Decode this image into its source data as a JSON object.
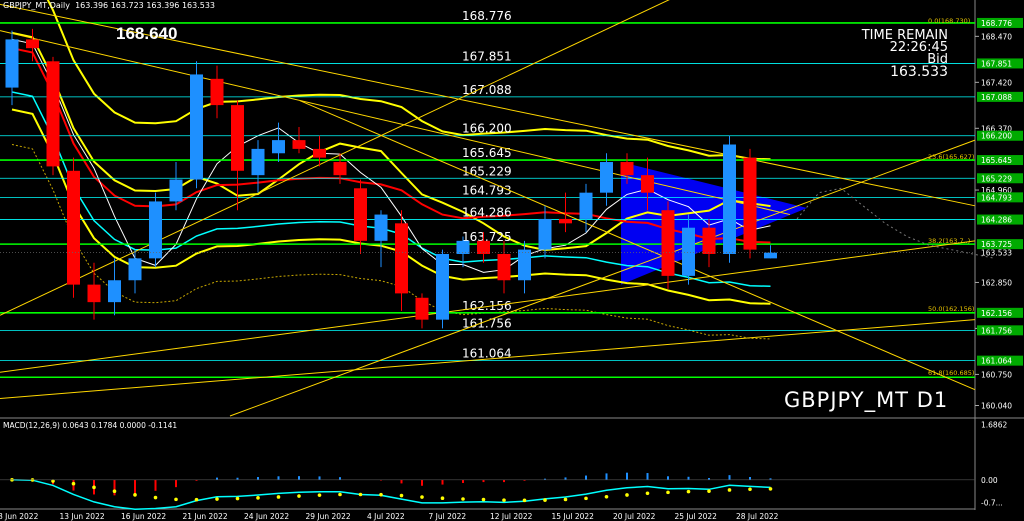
{
  "header": {
    "title": "GBPJPY_MT,Daily  163.396 163.723 163.396 163.533"
  },
  "high_label": "168.640",
  "timer": {
    "label": "TIME REMAIN",
    "value": "22:26:45",
    "bid_label": "Bid",
    "bid_value": "163.533"
  },
  "symbol_label": "GBPJPY_MT D1",
  "macd_header": "MACD(12,26,9) 0.0643 0.1784 0.0000 -0.1141",
  "colors": {
    "background": "#000000",
    "bull": "#1e90ff",
    "bear": "#ff0000",
    "level_line": "#00ff00",
    "level_thin": "#00ffff",
    "trend": "#ffd700",
    "ma_red": "#ff0000",
    "ma_cyan": "#00ffff",
    "ma_white": "#ffffff",
    "envelope": "#ffff00",
    "triangle": "#0000ff",
    "macd_signal": "#ffff00"
  },
  "chart_data": [
    {
      "type": "candlestick",
      "ylim": [
        159.8,
        169.3
      ],
      "price_axis_ticks": [
        "168.470",
        "167.420",
        "166.370",
        "164.960",
        "162.850",
        "161.800",
        "160.750",
        "160.040"
      ],
      "price_axis_labels": [
        {
          "value": 168.776,
          "text": "168.776"
        },
        {
          "value": 168.47,
          "text": "168.470"
        },
        {
          "value": 167.851,
          "text": "167.851"
        },
        {
          "value": 167.42,
          "text": "167.420"
        },
        {
          "value": 167.088,
          "text": "167.088"
        },
        {
          "value": 166.37,
          "text": "166.370"
        },
        {
          "value": 166.2,
          "text": "166.200"
        },
        {
          "value": 165.645,
          "text": "165.645"
        },
        {
          "value": 165.229,
          "text": "165.229"
        },
        {
          "value": 164.96,
          "text": "164.960"
        },
        {
          "value": 164.793,
          "text": "164.793"
        },
        {
          "value": 164.286,
          "text": "164.286"
        },
        {
          "value": 163.725,
          "text": "163.725"
        },
        {
          "value": 163.533,
          "text": "163.533"
        },
        {
          "value": 162.85,
          "text": "162.850"
        },
        {
          "value": 162.156,
          "text": "162.156"
        },
        {
          "value": 161.756,
          "text": "161.756"
        },
        {
          "value": 161.064,
          "text": "161.064"
        },
        {
          "value": 160.75,
          "text": "160.750"
        },
        {
          "value": 160.04,
          "text": "160.040"
        }
      ],
      "levels": [
        {
          "price": 168.776,
          "label": "168.776",
          "style": "bold"
        },
        {
          "price": 167.851,
          "label": "167.851",
          "style": "thin"
        },
        {
          "price": 167.088,
          "label": "167.088",
          "style": "thin"
        },
        {
          "price": 166.2,
          "label": "166.200",
          "style": "thin"
        },
        {
          "price": 165.645,
          "label": "165.645",
          "style": "bold"
        },
        {
          "price": 165.229,
          "label": "165.229",
          "style": "thin"
        },
        {
          "price": 164.793,
          "label": "164.793",
          "style": "thin"
        },
        {
          "price": 164.286,
          "label": "164.286",
          "style": "thin"
        },
        {
          "price": 163.725,
          "label": "163.725",
          "style": "bold"
        },
        {
          "price": 162.156,
          "label": "162.156",
          "style": "bold"
        },
        {
          "price": 161.756,
          "label": "161.756",
          "style": "thin"
        },
        {
          "price": 161.064,
          "label": "161.064",
          "style": "thin"
        },
        {
          "price": 160.685,
          "label": "",
          "style": "bold"
        }
      ],
      "fib_labels": [
        {
          "price": 168.73,
          "text": "0.0(168.730)"
        },
        {
          "price": 165.627,
          "text": "23.6(165.627)"
        },
        {
          "price": 163.7,
          "text": "38.2(163.7..)"
        },
        {
          "price": 162.156,
          "text": "50.0(162.156)"
        },
        {
          "price": 160.685,
          "text": "61.8(160.685)"
        }
      ],
      "x_labels": [
        {
          "bar": 0,
          "text": "8 Jun 2022"
        },
        {
          "bar": 3,
          "text": "13 Jun 2022"
        },
        {
          "bar": 6,
          "text": "16 Jun 2022"
        },
        {
          "bar": 9,
          "text": "21 Jun 2022"
        },
        {
          "bar": 12,
          "text": "24 Jun 2022"
        },
        {
          "bar": 15,
          "text": "29 Jun 2022"
        },
        {
          "bar": 18,
          "text": "4 Jul 2022"
        },
        {
          "bar": 21,
          "text": "7 Jul 2022"
        },
        {
          "bar": 24,
          "text": "12 Jul 2022"
        },
        {
          "bar": 27,
          "text": "15 Jul 2022"
        },
        {
          "bar": 30,
          "text": "20 Jul 2022"
        },
        {
          "bar": 33,
          "text": "25 Jul 2022"
        },
        {
          "bar": 36,
          "text": "28 Jul 2022"
        }
      ],
      "candles": [
        {
          "o": 167.3,
          "h": 168.6,
          "l": 166.9,
          "c": 168.4
        },
        {
          "o": 168.4,
          "h": 168.64,
          "l": 167.9,
          "c": 168.2
        },
        {
          "o": 167.9,
          "h": 168.0,
          "l": 165.3,
          "c": 165.5
        },
        {
          "o": 165.4,
          "h": 165.7,
          "l": 162.5,
          "c": 162.8
        },
        {
          "o": 162.8,
          "h": 163.3,
          "l": 162.0,
          "c": 162.4
        },
        {
          "o": 162.4,
          "h": 163.4,
          "l": 162.1,
          "c": 162.9
        },
        {
          "o": 162.9,
          "h": 163.6,
          "l": 162.6,
          "c": 163.4
        },
        {
          "o": 163.4,
          "h": 164.9,
          "l": 163.2,
          "c": 164.7
        },
        {
          "o": 164.7,
          "h": 165.6,
          "l": 164.5,
          "c": 165.2
        },
        {
          "o": 165.2,
          "h": 167.9,
          "l": 165.0,
          "c": 167.6
        },
        {
          "o": 167.5,
          "h": 167.8,
          "l": 166.6,
          "c": 166.9
        },
        {
          "o": 166.9,
          "h": 167.0,
          "l": 164.5,
          "c": 165.4
        },
        {
          "o": 165.3,
          "h": 166.1,
          "l": 164.9,
          "c": 165.9
        },
        {
          "o": 165.8,
          "h": 166.5,
          "l": 165.6,
          "c": 166.1
        },
        {
          "o": 166.1,
          "h": 166.4,
          "l": 165.8,
          "c": 165.9
        },
        {
          "o": 165.9,
          "h": 166.2,
          "l": 165.5,
          "c": 165.7
        },
        {
          "o": 165.6,
          "h": 165.8,
          "l": 165.1,
          "c": 165.3
        },
        {
          "o": 165.0,
          "h": 165.2,
          "l": 163.5,
          "c": 163.8
        },
        {
          "o": 163.8,
          "h": 164.5,
          "l": 163.2,
          "c": 164.4
        },
        {
          "o": 164.2,
          "h": 164.5,
          "l": 162.2,
          "c": 162.6
        },
        {
          "o": 162.5,
          "h": 162.6,
          "l": 161.8,
          "c": 162.0
        },
        {
          "o": 162.0,
          "h": 163.6,
          "l": 161.8,
          "c": 163.5
        },
        {
          "o": 163.5,
          "h": 163.9,
          "l": 163.2,
          "c": 163.8
        },
        {
          "o": 163.8,
          "h": 164.0,
          "l": 163.3,
          "c": 163.5
        },
        {
          "o": 163.5,
          "h": 163.8,
          "l": 162.6,
          "c": 162.9
        },
        {
          "o": 162.9,
          "h": 163.8,
          "l": 162.6,
          "c": 163.6
        },
        {
          "o": 163.6,
          "h": 164.6,
          "l": 163.4,
          "c": 164.3
        },
        {
          "o": 164.3,
          "h": 164.9,
          "l": 164.0,
          "c": 164.2
        },
        {
          "o": 164.3,
          "h": 165.1,
          "l": 164.0,
          "c": 164.9
        },
        {
          "o": 164.9,
          "h": 165.8,
          "l": 164.6,
          "c": 165.6
        },
        {
          "o": 165.6,
          "h": 165.8,
          "l": 165.1,
          "c": 165.3
        },
        {
          "o": 165.3,
          "h": 165.7,
          "l": 164.5,
          "c": 164.9
        },
        {
          "o": 164.5,
          "h": 164.7,
          "l": 162.7,
          "c": 163.0
        },
        {
          "o": 163.0,
          "h": 164.4,
          "l": 162.8,
          "c": 164.1
        },
        {
          "o": 164.1,
          "h": 164.3,
          "l": 163.2,
          "c": 163.5
        },
        {
          "o": 163.5,
          "h": 166.2,
          "l": 163.3,
          "c": 166.0
        },
        {
          "o": 165.7,
          "h": 165.9,
          "l": 163.4,
          "c": 163.6
        },
        {
          "o": 163.4,
          "h": 163.7,
          "l": 163.4,
          "c": 163.53
        }
      ]
    },
    {
      "type": "macd",
      "label": "MACD(12,26,9)",
      "values_text": [
        "0.0643",
        "0.1784",
        "0.0000",
        "-0.1141"
      ],
      "ylim": [
        -0.8,
        1.8
      ],
      "axis_labels": [
        {
          "value": 1.6862,
          "text": "1.6862"
        },
        {
          "value": 0.0,
          "text": "0.00"
        },
        {
          "value": -0.7,
          "text": "-0.7..."
        }
      ]
    }
  ]
}
